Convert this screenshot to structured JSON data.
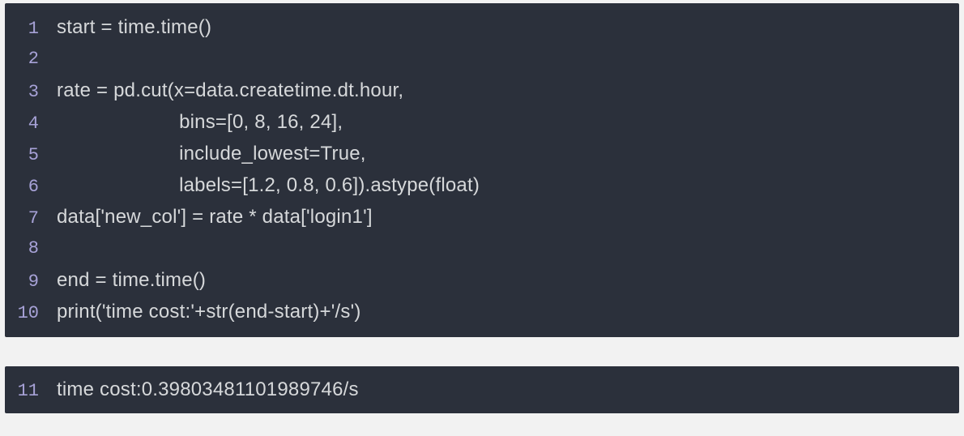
{
  "input_block": {
    "lines": [
      {
        "num": "1",
        "text": "start = time.time()"
      },
      {
        "num": "2",
        "text": ""
      },
      {
        "num": "3",
        "text": "rate = pd.cut(x=data.createtime.dt.hour,"
      },
      {
        "num": "4",
        "text": "                      bins=[0, 8, 16, 24],"
      },
      {
        "num": "5",
        "text": "                      include_lowest=True,"
      },
      {
        "num": "6",
        "text": "                      labels=[1.2, 0.8, 0.6]).astype(float)"
      },
      {
        "num": "7",
        "text": "data['new_col'] = rate * data['login1']"
      },
      {
        "num": "8",
        "text": ""
      },
      {
        "num": "9",
        "text": "end = time.time()"
      },
      {
        "num": "10",
        "text": "print('time cost:'+str(end-start)+'/s')"
      }
    ]
  },
  "output_block": {
    "lines": [
      {
        "num": "11",
        "text": "time cost:0.39803481101989746/s"
      }
    ]
  }
}
